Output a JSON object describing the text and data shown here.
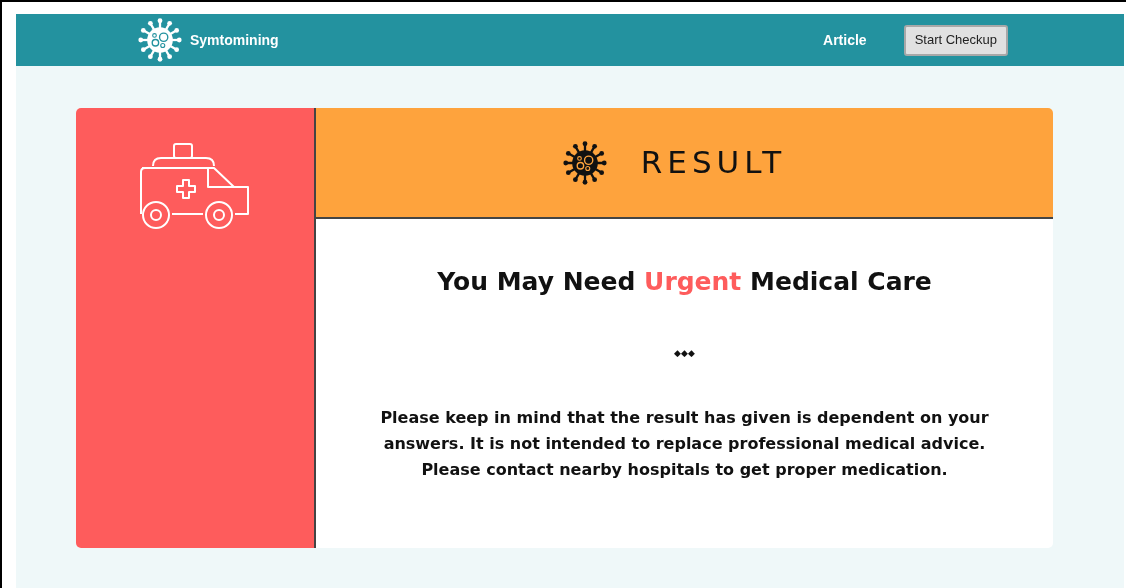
{
  "navbar": {
    "brand": "Symtomining",
    "links": [
      "Article"
    ],
    "button": "Start Checkup"
  },
  "result": {
    "header": "RESULT",
    "title": {
      "before": "You May Need",
      "highlight": "Urgent",
      "after": "Medical Care"
    },
    "divider": "◆◆◆",
    "message": "Please keep in mind that the result has given is dependent on your answers. It is not intended to replace professional medical advice. Please contact nearby hospitals to get proper medication."
  }
}
